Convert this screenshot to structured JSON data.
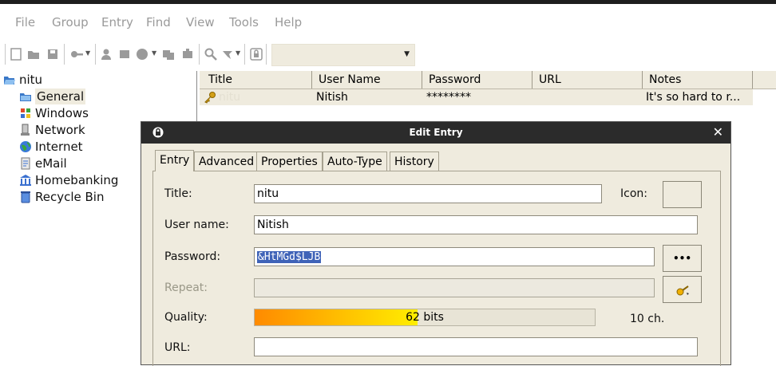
{
  "menu": [
    "File",
    "Group",
    "Entry",
    "Find",
    "View",
    "Tools",
    "Help"
  ],
  "toolbar": {
    "icons": [
      "new-database-icon",
      "open-database-icon",
      "save-icon",
      "add-entry-icon",
      "copy-username-icon",
      "copy-password-icon",
      "open-url-icon",
      "copy-url-icon",
      "plugin-icon",
      "find-icon",
      "find-options-icon",
      "lock-workspace-icon"
    ],
    "quick_find_value": ""
  },
  "tree": {
    "root": "nitu",
    "groups": [
      "General",
      "Windows",
      "Network",
      "Internet",
      "eMail",
      "Homebanking",
      "Recycle Bin"
    ],
    "selected": "General"
  },
  "entry_list": {
    "columns": [
      "Title",
      "User Name",
      "Password",
      "URL",
      "Notes"
    ],
    "rows": [
      {
        "title": "nitu",
        "username": "Nitish",
        "password": "********",
        "url": "",
        "notes": "It's so hard to r..."
      }
    ]
  },
  "dialog": {
    "title": "Edit Entry",
    "close": "✕",
    "tabs": [
      "Entry",
      "Advanced",
      "Properties",
      "Auto-Type",
      "History"
    ],
    "active_tab": "Entry",
    "fields": {
      "title_label": "Title:",
      "title_value": "nitu",
      "icon_label": "Icon:",
      "username_label": "User name:",
      "username_value": "Nitish",
      "password_label": "Password:",
      "password_value": "&HtMGd$LJB",
      "show_password_button": "•••",
      "repeat_label": "Repeat:",
      "repeat_value": "",
      "quality_label": "Quality:",
      "quality_text": "62 bits",
      "quality_level": 0.48,
      "length_text": "10 ch.",
      "url_label": "URL:",
      "url_value": ""
    }
  },
  "colors": {
    "chrome": "#efebde",
    "selection": "#3f63b8",
    "quality_start": "#ff8a00",
    "quality_end": "#ffee00",
    "titlebar": "#2b2b2b"
  }
}
